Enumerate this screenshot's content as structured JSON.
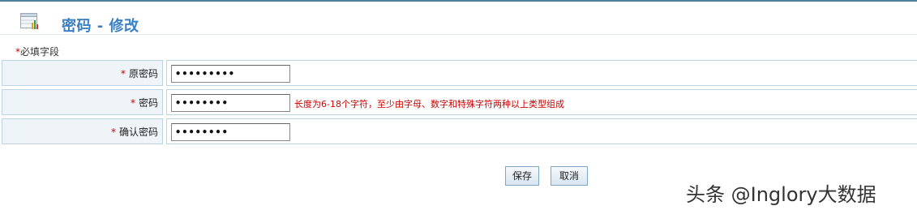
{
  "header": {
    "title": "密码 - 修改",
    "icon": "table-icon"
  },
  "required_note": {
    "star": "*",
    "text": "必填字段"
  },
  "form": {
    "rows": [
      {
        "star": "*",
        "label": "原密码",
        "value": "•••••••••"
      },
      {
        "star": "*",
        "label": "密码",
        "value": "••••••••",
        "hint": "长度为6-18个字符，至少由字母、数字和特殊字符两种以上类型组成"
      },
      {
        "star": "*",
        "label": "确认密码",
        "value": "••••••••"
      }
    ]
  },
  "buttons": {
    "save": "保存",
    "cancel": "取消"
  },
  "watermark": "头条 @Inglory大数据",
  "colors": {
    "title": "#3b7fc4",
    "required": "#cc0000",
    "label_bg": "#eef4f8",
    "border": "#bcd3e3"
  }
}
